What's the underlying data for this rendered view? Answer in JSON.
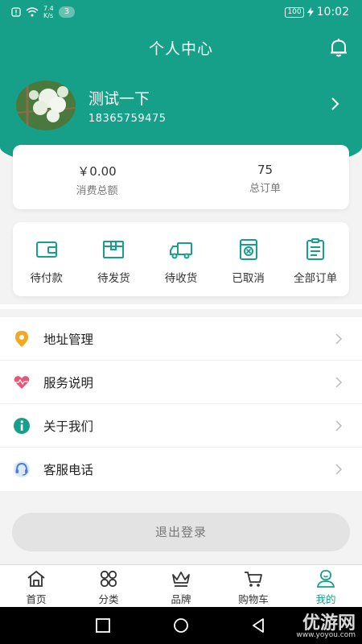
{
  "status_bar": {
    "speed": "7.4\nK/s",
    "notif_count": "3",
    "battery": "100",
    "time": "10:02"
  },
  "header": {
    "title": "个人中心"
  },
  "profile": {
    "username": "测试一下",
    "phone": "18365759475"
  },
  "stats": [
    {
      "value": "￥0.00",
      "label": "消费总额"
    },
    {
      "value": "75",
      "label": "总订单"
    }
  ],
  "orders": [
    {
      "label": "待付款",
      "icon": "wallet-icon"
    },
    {
      "label": "待发货",
      "icon": "package-icon"
    },
    {
      "label": "待收货",
      "icon": "truck-icon"
    },
    {
      "label": "已取消",
      "icon": "cancel-icon"
    },
    {
      "label": "全部订单",
      "icon": "clipboard-icon"
    }
  ],
  "menu": [
    {
      "label": "地址管理",
      "icon": "location-icon"
    },
    {
      "label": "服务说明",
      "icon": "heart-icon"
    },
    {
      "label": "关于我们",
      "icon": "info-icon"
    },
    {
      "label": "客服电话",
      "icon": "headset-icon"
    }
  ],
  "logout_label": "退出登录",
  "tabs": [
    {
      "label": "首页",
      "icon": "home-icon"
    },
    {
      "label": "分类",
      "icon": "grid-icon"
    },
    {
      "label": "品牌",
      "icon": "crown-icon"
    },
    {
      "label": "购物车",
      "icon": "cart-icon"
    },
    {
      "label": "我的",
      "icon": "user-icon"
    }
  ],
  "watermark": {
    "main": "优游网",
    "sub": "www.yoyou.com"
  },
  "colors": {
    "accent": "#16a089",
    "location": "#f5a623",
    "heart": "#e8577a",
    "info": "#16a089",
    "headset": "#4a7ed9"
  }
}
